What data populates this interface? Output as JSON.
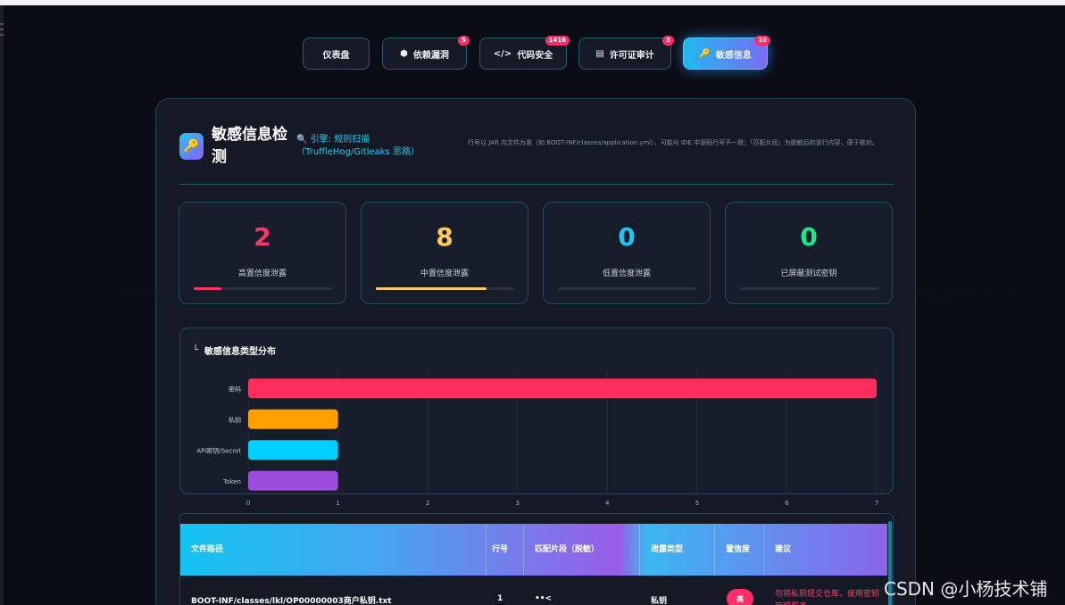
{
  "nav": {
    "items": [
      {
        "label": "仪表盘",
        "icon": "",
        "badge": ""
      },
      {
        "label": "依赖漏洞",
        "icon": "⬢",
        "badge": "5"
      },
      {
        "label": "代码安全",
        "icon": "</>",
        "badge": "1416"
      },
      {
        "label": "许可证审计",
        "icon": "▤",
        "badge": "3"
      },
      {
        "label": "敏感信息",
        "icon": "🔑",
        "badge": "10"
      }
    ],
    "active": 4
  },
  "header": {
    "title": "敏感信息检测",
    "engine": "🔍 引擎: 规则扫描（TruffleHog/Gitleaks 思路）",
    "note": "行号以 JAR 内文件为准（如 BOOT-INF/classes/application.yml），可能与 IDE 中源码行号不一致；「匹配片段」为脱敏后的该行内容，便于核对。"
  },
  "stats": [
    {
      "value": "2",
      "label": "高置信度泄露",
      "color": "#ff3565",
      "fill": 0.2
    },
    {
      "value": "8",
      "label": "中置信度泄露",
      "color": "#ffcb5c",
      "fill": 0.8
    },
    {
      "value": "0",
      "label": "低置信度泄露",
      "color": "#1ec8f2",
      "fill": 0
    },
    {
      "value": "0",
      "label": "已屏蔽测试密钥",
      "color": "#1ee88a",
      "fill": 0
    }
  ],
  "chart_title": "敏感信息类型分布",
  "chart_data": {
    "type": "bar",
    "orientation": "horizontal",
    "categories": [
      "密码",
      "私钥",
      "API密钥/Secret",
      "Token"
    ],
    "values": [
      7,
      1,
      1,
      1
    ],
    "colors": [
      "#ff2d5e",
      "#ff9f00",
      "#00cfff",
      "#9b4ddb"
    ],
    "xlim": [
      0,
      7
    ],
    "xticks": [
      "0",
      "1",
      "2",
      "3",
      "4",
      "5",
      "6",
      "7"
    ],
    "grid": true
  },
  "table": {
    "headers": [
      "文件路径",
      "行号",
      "匹配片段（脱敏）",
      "泄露类型",
      "置信度",
      "建议"
    ],
    "rows": [
      {
        "path": "BOOT-INF/classes/lkl/OP00000003商户私钥.txt",
        "line": "1",
        "snippet": "••<",
        "type": "私钥",
        "confidence": "高",
        "advice": "勿将私钥提交仓库，使用密钥管理服务"
      }
    ]
  },
  "watermark": "CSDN @小杨技术铺"
}
